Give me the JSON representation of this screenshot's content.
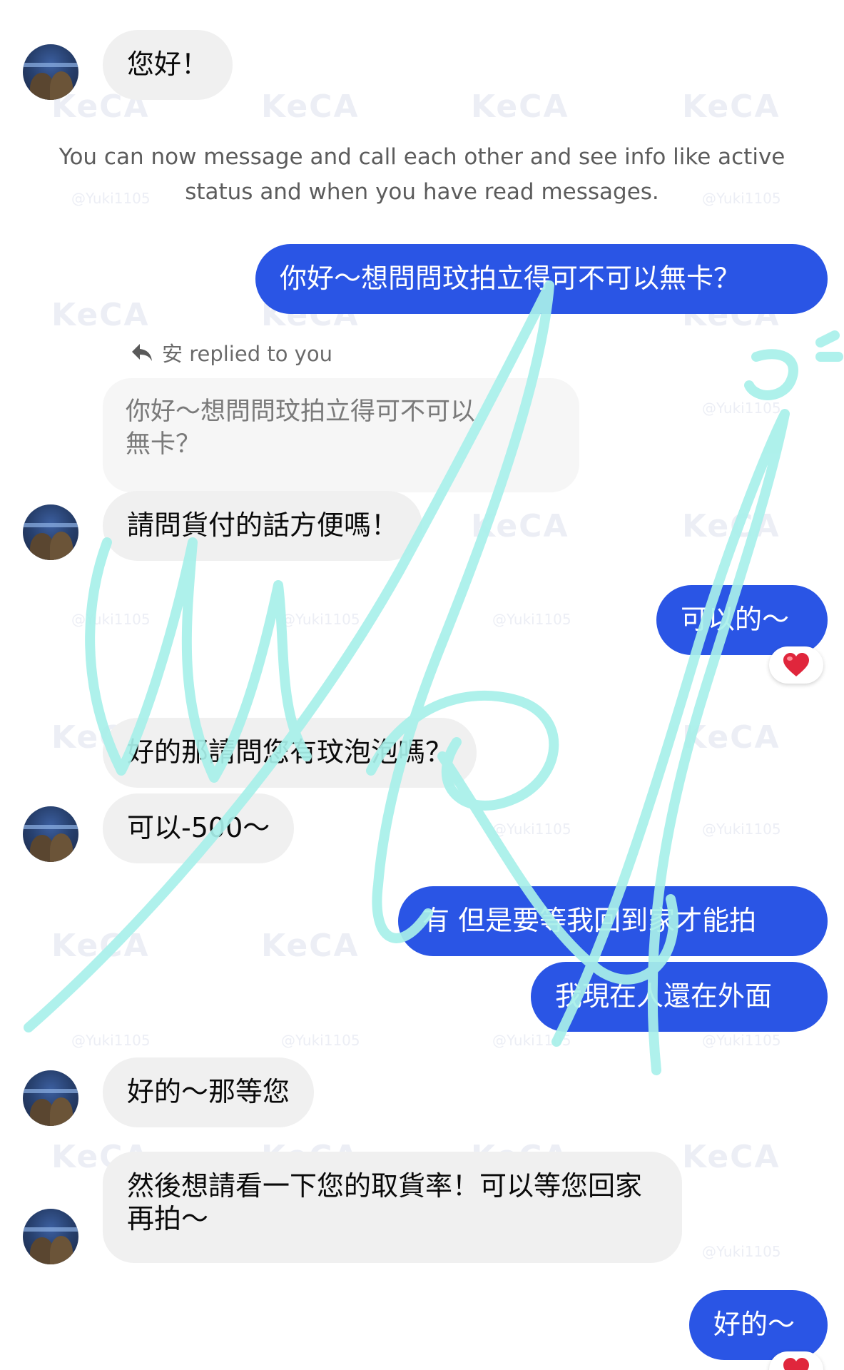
{
  "chat": {
    "msg1": "您好！",
    "system_note": "You can now message and call each other and see info like active status and when you have read messages.",
    "out1": "你好～想問問玟拍立得可不可以無卡？",
    "reply_header": "安 replied to you",
    "quoted_line1": "你好～想問問玟拍立得可不可以",
    "quoted_line2": "無卡？",
    "msg2": "請問貨付的話方便嗎！",
    "out2": "可以的～",
    "reaction_emoji": "❤️",
    "msg3": "好的那請問您有玟泡泡嗎？",
    "msg4": "可以-500～",
    "out3": "有 但是要等我回到家才能拍",
    "out4": "我現在人還在外面",
    "msg5": "好的～那等您",
    "msg6": "然後想請看一下您的取貨率！可以等您回家再拍～",
    "out5": "好的～"
  },
  "watermark": {
    "logo": "KeCA",
    "handle": "@Yuki1105"
  },
  "colors": {
    "outgoing_bubble": "#2a55e5",
    "incoming_bubble": "#f0f0f0",
    "signature": "#a8f0ea"
  },
  "icons": {
    "reply": "reply-arrow-icon",
    "heart": "heart-icon"
  }
}
